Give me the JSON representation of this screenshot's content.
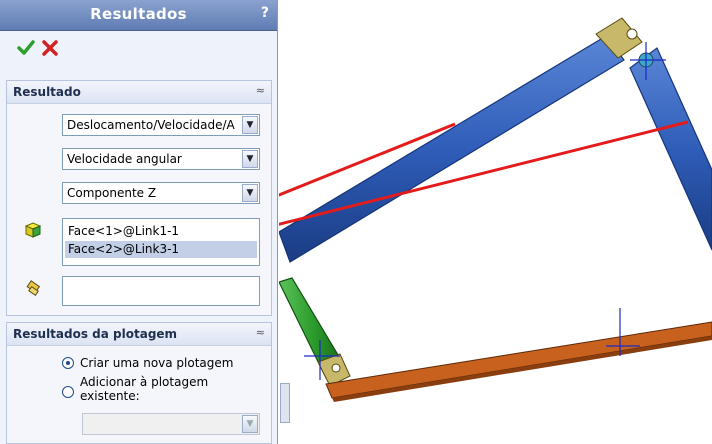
{
  "panel": {
    "title": "Resultados",
    "help_glyph": "?",
    "ok_icon": "check-icon",
    "cancel_icon": "close-icon"
  },
  "resultado": {
    "header": "Resultado",
    "collapse_glyph": "≈",
    "category": "Deslocamento/Velocidade/A",
    "subcategory": "Velocidade angular",
    "component": "Componente Z",
    "faces": [
      "Face<1>@Link1-1",
      "Face<2>@Link3-1"
    ],
    "face_icon": "cube-icon",
    "reference_icon": "reference-part-icon",
    "reference_value": ""
  },
  "plot": {
    "header": "Resultados da plotagem",
    "collapse_glyph": "≈",
    "option_new": "Criar uma nova plotagem",
    "option_add": "Adicionar à plotagem existente:",
    "selected": "new",
    "existing_plot": ""
  },
  "colors": {
    "link_blue": "#2f5db8",
    "link_green": "#2e9e2e",
    "link_orange": "#c8601e",
    "arrow_red": "#e41b1b",
    "selection": "#c2cfe6"
  }
}
